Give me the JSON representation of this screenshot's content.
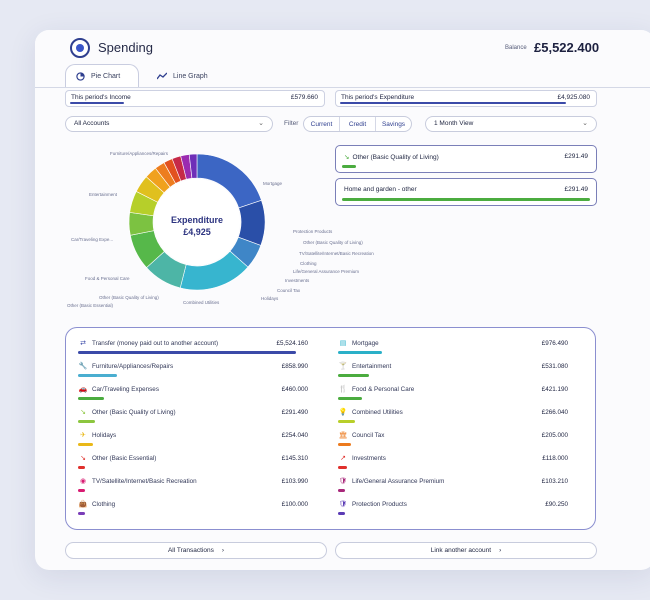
{
  "header": {
    "title": "Spending",
    "balance_label": "Balance",
    "balance_value": "£5,522.400"
  },
  "tabs": [
    {
      "label": "Pie Chart",
      "icon": "pie-chart-icon",
      "active": true
    },
    {
      "label": "Line Graph",
      "icon": "line-graph-icon",
      "active": false
    }
  ],
  "period": {
    "income_label": "This period's Income",
    "income_value": "£579.660",
    "expenditure_label": "This period's Expenditure",
    "expenditure_value": "£4,925.080"
  },
  "filters": {
    "accounts": "All Accounts",
    "filter_label": "Filter",
    "segments": [
      "Current",
      "Credit",
      "Savings"
    ],
    "view": "1 Month View"
  },
  "donut": {
    "center_title": "Expenditure",
    "center_value": "£4,925",
    "labels": [
      "Furniture/Appliances/Repairs",
      "Mortgage",
      "Entertainment",
      "Protection Products",
      "Other (Basic Quality of Living)",
      "TV/Satellite/Internet/Basic Recreation",
      "Clothing",
      "Life/General Assurance Premium",
      "Car/Traveling Expe...",
      "Investments",
      "Council Tax",
      "Food & Personal Care",
      "Holidays",
      "Combined Utilities",
      "Other (Basic Quality of Living)",
      "Other (Basic Essential)"
    ],
    "colors": [
      "#3c66c4",
      "#2a4fa8",
      "#3f86c7",
      "#37b5cf",
      "#4db5a6",
      "#56b84a",
      "#7cc241",
      "#b6cf2a",
      "#e0c01e",
      "#f0a11e",
      "#ed7d1f",
      "#e2521f",
      "#c62a48",
      "#9b2bb0",
      "#6e2fb8",
      "#4b43b6"
    ],
    "segments": [
      976.49,
      531.08,
      291.49,
      858.99,
      460.0,
      421.19,
      266.04,
      254.04,
      205.0,
      145.31,
      118.0,
      103.99,
      103.21,
      100.0,
      90.25
    ]
  },
  "selected": [
    {
      "label": "Other (Basic Quality of Living)",
      "value": "£291.49",
      "icon": "trend-down-icon"
    },
    {
      "label": "Home and garden - other",
      "value": "£291.49"
    }
  ],
  "categories_left": [
    {
      "name": "Transfer (money paid out to another account)",
      "amount": "£5,524.160",
      "icon": "⇄",
      "color": "#3b4aa8",
      "fill": 1.0
    },
    {
      "name": "Furniture/Appliances/Repairs",
      "amount": "£858.990",
      "icon": "🔧",
      "color": "#4aaed0",
      "fill": 0.18
    },
    {
      "name": "Car/Traveling Expenses",
      "amount": "£460.000",
      "icon": "🚗",
      "color": "#4bac3f",
      "fill": 0.12
    },
    {
      "name": "Other (Basic Quality of Living)",
      "amount": "£291.490",
      "icon": "↘",
      "color": "#8cc63f",
      "fill": 0.08
    },
    {
      "name": "Holidays",
      "amount": "£254.040",
      "icon": "✈",
      "color": "#e9b818",
      "fill": 0.07
    },
    {
      "name": "Other (Basic Essential)",
      "amount": "£145.310",
      "icon": "↘",
      "color": "#e0302c",
      "fill": 0.03
    },
    {
      "name": "TV/Satellite/Internet/Basic Recreation",
      "amount": "£103.990",
      "icon": "◉",
      "color": "#d81b72",
      "fill": 0.03
    },
    {
      "name": "Clothing",
      "amount": "£100.000",
      "icon": "👜",
      "color": "#7a3db8",
      "fill": 0.03
    }
  ],
  "categories_right": [
    {
      "name": "Mortgage",
      "amount": "£976.490",
      "icon": "▤",
      "color": "#2ab0c8",
      "fill": 0.2
    },
    {
      "name": "Entertainment",
      "amount": "£531.080",
      "icon": "🍸",
      "color": "#4bac3f",
      "fill": 0.14
    },
    {
      "name": "Food & Personal Care",
      "amount": "£421.190",
      "icon": "🍴",
      "color": "#4bac3f",
      "fill": 0.11
    },
    {
      "name": "Combined Utilities",
      "amount": "£266.040",
      "icon": "💡",
      "color": "#b8cf2a",
      "fill": 0.08
    },
    {
      "name": "Council Tax",
      "amount": "£205.000",
      "icon": "🏛",
      "color": "#ec7a1e",
      "fill": 0.06
    },
    {
      "name": "Investments",
      "amount": "£118.000",
      "icon": "↗",
      "color": "#e0302c",
      "fill": 0.04
    },
    {
      "name": "Life/General Assurance Premium",
      "amount": "£103.210",
      "icon": "🛡",
      "color": "#a8287a",
      "fill": 0.03
    },
    {
      "name": "Protection Products",
      "amount": "£90.250",
      "icon": "🛡",
      "color": "#5b3bb5",
      "fill": 0.03
    }
  ],
  "buttons": {
    "transactions": "All Transactions",
    "link_account": "Link another account"
  }
}
